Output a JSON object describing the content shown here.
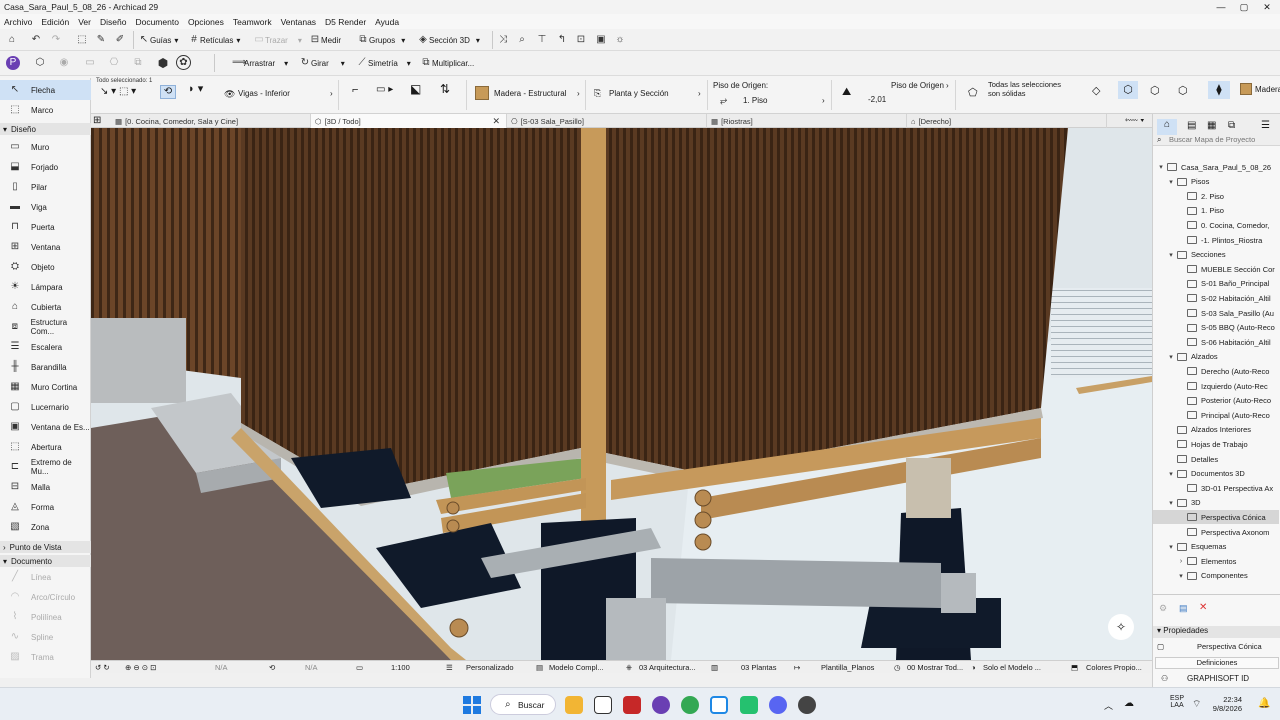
{
  "window": {
    "title": "Casa_Sara_Paul_5_08_26 - Archicad 29",
    "controls": [
      "—",
      "▢",
      "✕"
    ]
  },
  "menu": [
    "Archivo",
    "Edición",
    "Ver",
    "Diseño",
    "Documento",
    "Opciones",
    "Teamwork",
    "Ventanas",
    "D5 Render",
    "Ayuda"
  ],
  "toolbar1": {
    "guias": "Guías",
    "reticulas": "Retículas",
    "trazar": "Trazar",
    "medir": "Medir",
    "grupos": "Grupos",
    "seccion3d": "Sección 3D"
  },
  "toolbar2": {
    "arrastrar": "Arrastrar",
    "girar": "Girar",
    "simetria": "Simetría",
    "multiplicar": "Multiplicar..."
  },
  "infobox": {
    "seleccion": "Todo seleccionado: 1",
    "vigas": "Vigas - Inferior",
    "material": "Madera - Estructural",
    "planta": "Planta y Sección",
    "piso_origen_label": "Piso de Origen:",
    "piso_origen_value": "1. Piso",
    "piso_origen2_label": "Piso de Origen",
    "piso_origen2_value": "-2,01",
    "solidas": "Todas las selecciones son sólidas",
    "madera": "Madera"
  },
  "toolbox": {
    "items_top": [
      "Flecha",
      "Marco"
    ],
    "section_diseno": "Diseño",
    "items_diseno": [
      "Muro",
      "Forjado",
      "Pilar",
      "Viga",
      "Puerta",
      "Ventana",
      "Objeto",
      "Lámpara",
      "Cubierta",
      "Estructura Com...",
      "Escalera",
      "Barandilla",
      "Muro Cortina",
      "Lucernario",
      "Ventana de Es...",
      "Abertura",
      "Extremo de Mu...",
      "Malla",
      "Forma",
      "Zona"
    ],
    "section_punto": "Punto de Vista",
    "section_documento": "Documento",
    "items_documento": [
      "Línea",
      "Arco/Círculo",
      "Polilínea",
      "Spline",
      "Trama"
    ]
  },
  "tabs": [
    {
      "label": "[0. Cocina, Comedor, Sala y Cine]"
    },
    {
      "label": "[3D / Todo]"
    },
    {
      "label": "[S-03 Sala_Pasillo]"
    },
    {
      "label": "[Riostras]"
    },
    {
      "label": "[Derecho]"
    }
  ],
  "statusbar": {
    "na1": "N/A",
    "na2": "N/A",
    "scale": "1:100",
    "personalizado": "Personalizado",
    "modelo": "Modelo Compl...",
    "arquitectura": "03 Arquitectura...",
    "plantas": "03 Plantas",
    "plantilla": "Plantilla_Planos",
    "mostrar": "00 Mostrar Tod...",
    "solo": "Solo el Modelo ...",
    "colores": "Colores Propio..."
  },
  "navigator": {
    "search_placeholder": "Buscar Mapa de Proyecto",
    "project": "Casa_Sara_Paul_5_08_26",
    "pisos": "Pisos",
    "pisos_items": [
      "2. Piso",
      "1. Piso",
      "0. Cocina, Comedor,",
      "-1. Plintos_Riostra"
    ],
    "secciones": "Secciones",
    "secciones_items": [
      "MUEBLE Sección Cor",
      "S-01 Baño_Principal",
      "S-02 Habitación_Altil",
      "S-03 Sala_Pasillo (Au",
      "S-05 BBQ (Auto-Reco",
      "S-06 Habitación_Altil"
    ],
    "alzados": "Alzados",
    "alzados_items": [
      "Derecho (Auto-Reco",
      "Izquierdo (Auto-Rec",
      "Posterior (Auto-Reco",
      "Principal (Auto-Reco"
    ],
    "alzados_interiores": "Alzados Interiores",
    "hojas": "Hojas de Trabajo",
    "detalles": "Detalles",
    "documentos3d": "Documentos 3D",
    "doc3d_item": "3D-01 Perspectiva Ax",
    "tres_d": "3D",
    "tres_d_items": [
      "Perspectiva Cónica",
      "Perspectiva Axonom"
    ],
    "esquemas": "Esquemas",
    "elementos": "Elementos",
    "componentes": "Componentes",
    "propiedades": "Propiedades",
    "prop_value": "Perspectiva Cónica",
    "definiciones": "Definiciones",
    "graphisoft": "GRAPHISOFT ID"
  },
  "taskbar": {
    "search": "Buscar",
    "lang1": "ESP",
    "lang2": "LAA",
    "time": "22:34",
    "date": "9/8/2026"
  }
}
